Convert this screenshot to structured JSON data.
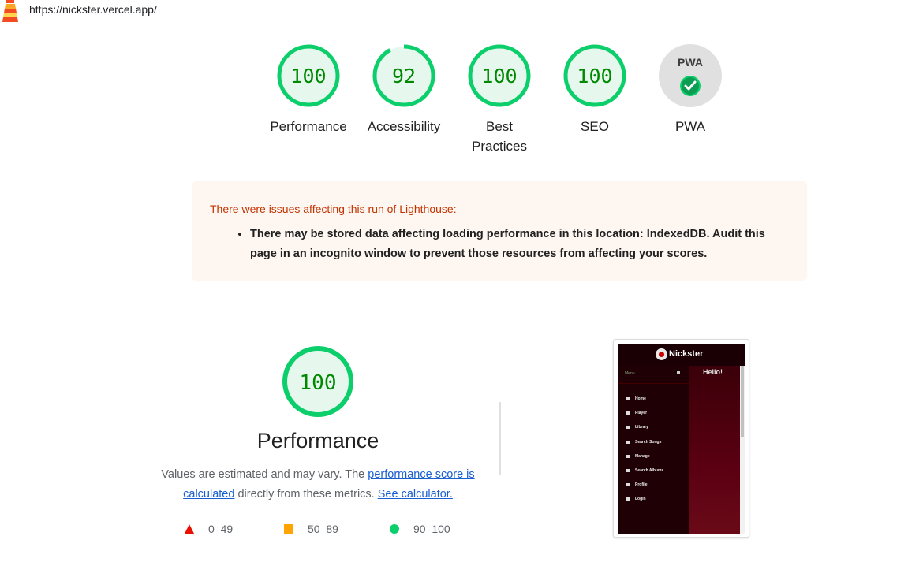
{
  "header": {
    "url": "https://nickster.vercel.app/"
  },
  "gauges": [
    {
      "label": "Performance",
      "score": "100",
      "fraction": 1.0
    },
    {
      "label": "Accessibility",
      "score": "92",
      "fraction": 0.92
    },
    {
      "label": "Best Practices",
      "score": "100",
      "fraction": 1.0
    },
    {
      "label": "SEO",
      "score": "100",
      "fraction": 1.0
    },
    {
      "label": "PWA",
      "badge": "PWA"
    }
  ],
  "warning": {
    "title": "There were issues affecting this run of Lighthouse:",
    "items": [
      "There may be stored data affecting loading performance in this location: IndexedDB. Audit this page in an incognito window to prevent those resources from affecting your scores."
    ]
  },
  "performance": {
    "score": "100",
    "title": "Performance",
    "desc_prefix": "Values are estimated and may vary. The ",
    "link1": "performance score is calculated",
    "desc_middle": " directly from these metrics. ",
    "link2": "See calculator."
  },
  "legend": [
    {
      "range": "0–49",
      "color": "#eb0f00",
      "shape": "triangle"
    },
    {
      "range": "50–89",
      "color": "#ffa400",
      "shape": "square"
    },
    {
      "range": "90–100",
      "color": "#0cce6b",
      "shape": "circle"
    }
  ],
  "thumbnail": {
    "app_name": "Nickster",
    "menu_label": "Menu",
    "greeting": "Hello!",
    "menu_items": [
      "Home",
      "Player",
      "Library",
      "Search Songs",
      "Manage",
      "Search Albums",
      "Profile",
      "Login"
    ]
  },
  "colors": {
    "pass_green": "#0cce6b",
    "pass_fill": "#e6f8ee",
    "pass_text": "#008800",
    "warning_bg": "#fdf6f1",
    "warning_title": "#c33300",
    "link": "#1a5fd0"
  }
}
